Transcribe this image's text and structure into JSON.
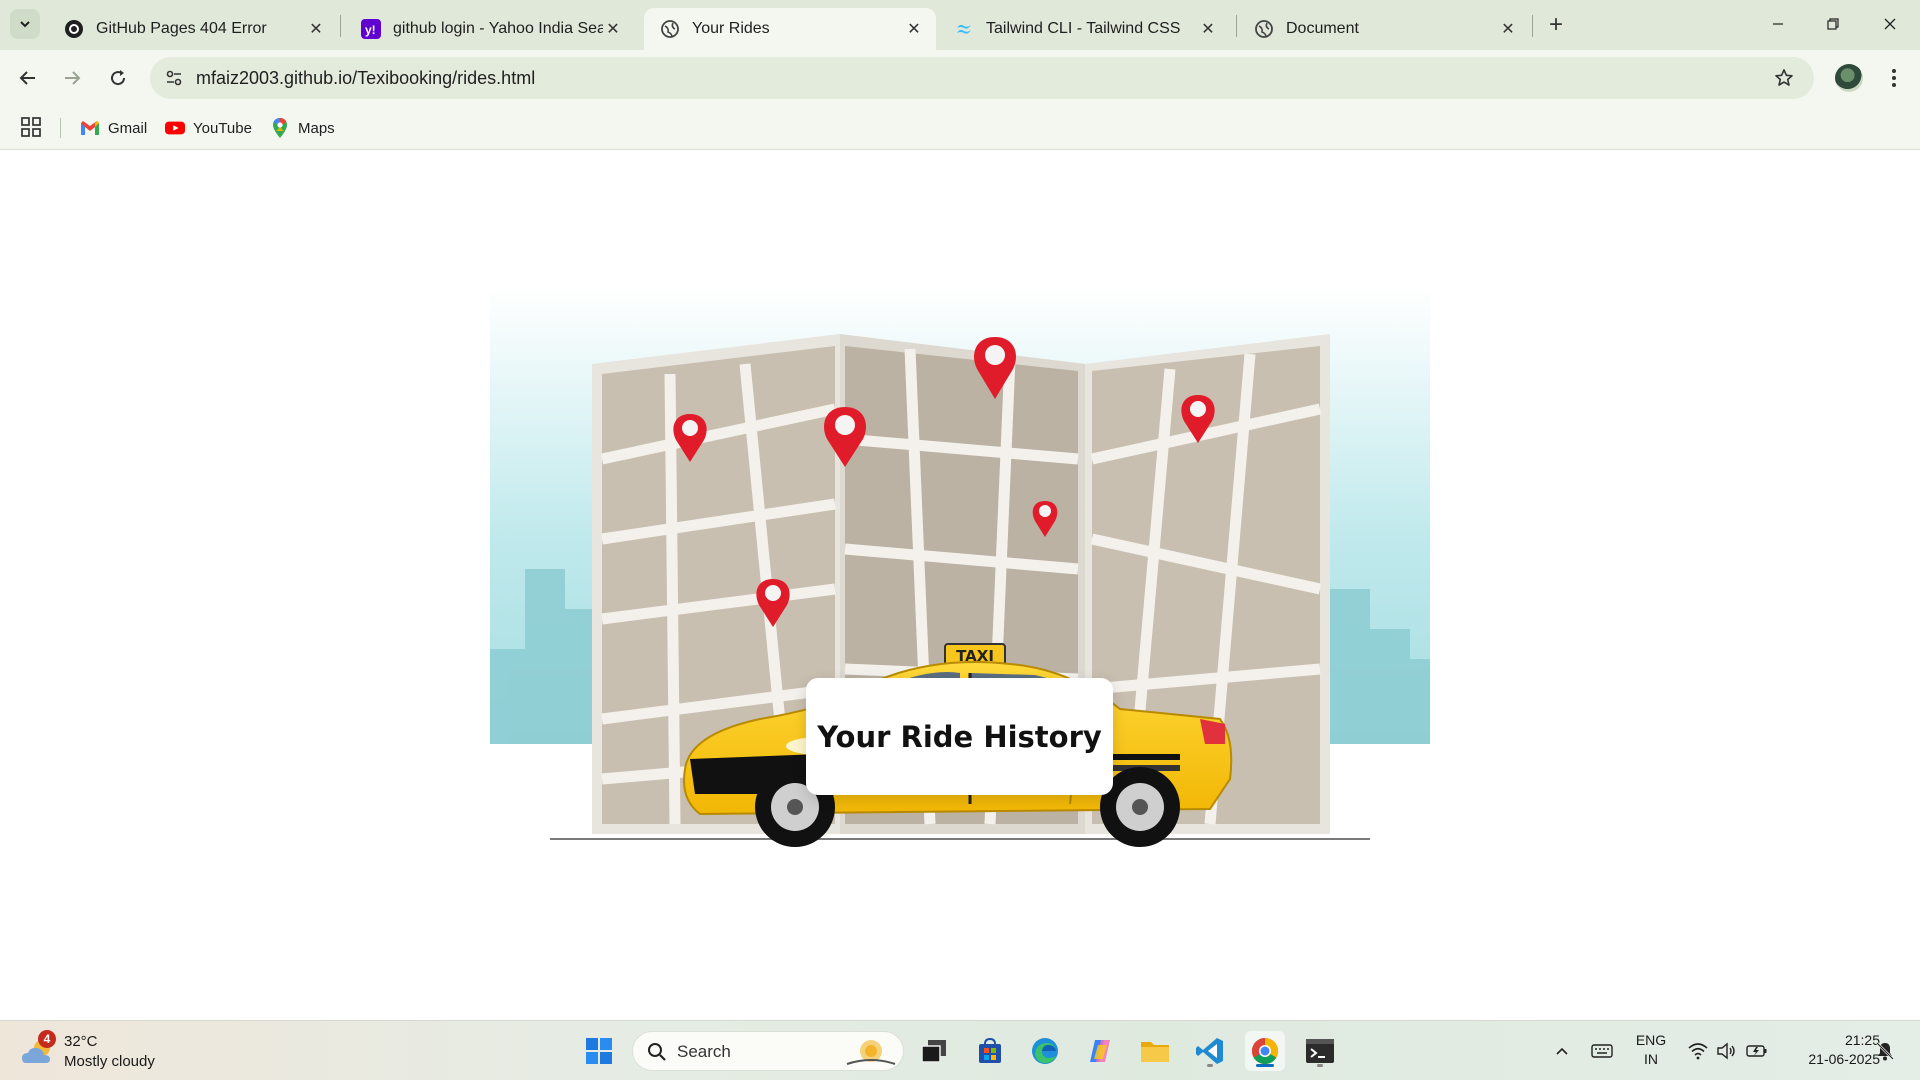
{
  "browser": {
    "tabs": [
      {
        "title": "GitHub Pages 404 Error",
        "icon": "github-icon",
        "active": false
      },
      {
        "title": "github login - Yahoo India Search",
        "icon": "yahoo-icon",
        "active": false
      },
      {
        "title": "Your Rides",
        "icon": "globe-icon",
        "active": true
      },
      {
        "title": "Tailwind CLI - Tailwind CSS",
        "icon": "tailwind-icon",
        "active": false
      },
      {
        "title": "Document",
        "icon": "globe-icon",
        "active": false
      }
    ],
    "url": "mfaiz2003.github.io/Texibooking/rides.html",
    "bookmarks": [
      {
        "label": "Gmail",
        "icon": "gmail-icon"
      },
      {
        "label": "YouTube",
        "icon": "youtube-icon"
      },
      {
        "label": "Maps",
        "icon": "maps-icon"
      }
    ]
  },
  "page": {
    "heading": "Your Ride History",
    "hero_image": {
      "taxi_sign": "TAXI"
    },
    "colors": {
      "taxi_yellow": "#f7c51c",
      "map_tan": "#c9bfb0",
      "pin_red": "#e01c2b",
      "sky_teal": "#a9dfe3"
    }
  },
  "taskbar": {
    "weather": {
      "temperature": "32°C",
      "condition": "Mostly cloudy",
      "badge": "4"
    },
    "search_label": "Search",
    "language": {
      "line1": "ENG",
      "line2": "IN"
    },
    "time": "21:25",
    "date": "21-06-2025"
  }
}
